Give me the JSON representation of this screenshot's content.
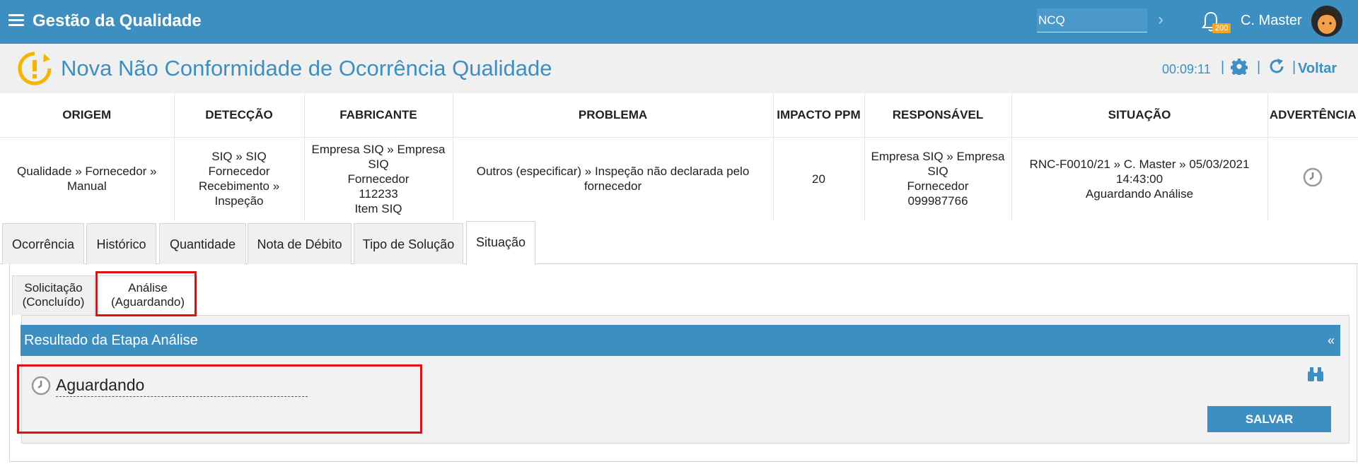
{
  "topbar": {
    "app_title": "Gestão da Qualidade",
    "search_value": "NCQ",
    "notification_count": "200",
    "user_name": "C. Master",
    "icons": [
      "menu-icon",
      "chevron-right-icon",
      "bell-icon",
      "avatar"
    ],
    "colors": {
      "bar": "#3d8fc1",
      "badge": "#f5a623"
    }
  },
  "header": {
    "title": "Nova Não Conformidade de Ocorrência Qualidade",
    "timer": "00:09:11",
    "back_label": "Voltar",
    "icons": [
      "warning-cycle-icon",
      "gear-icon",
      "refresh-icon"
    ]
  },
  "summary": {
    "columns": [
      "ORIGEM",
      "DETECÇÃO",
      "FABRICANTE",
      "PROBLEMA",
      "IMPACTO PPM",
      "RESPONSÁVEL",
      "SITUAÇÃO",
      "ADVERTÊNCIA"
    ],
    "row": {
      "origem": [
        "Qualidade » Fornecedor »",
        "Manual"
      ],
      "deteccao": [
        "SIQ » SIQ",
        "Fornecedor",
        "Recebimento »",
        "Inspeção"
      ],
      "fabricante": [
        "Empresa SIQ » Empresa",
        "SIQ",
        "Fornecedor",
        "112233",
        "Item SIQ"
      ],
      "problema": [
        "Outros (especificar) » Inspeção não declarada pelo",
        "fornecedor"
      ],
      "impacto_ppm": "20",
      "responsavel": [
        "Empresa SIQ » Empresa",
        "SIQ",
        "Fornecedor",
        "099987766"
      ],
      "situacao": [
        "RNC-F0010/21 » C. Master » 05/03/2021",
        "14:43:00",
        "Aguardando Análise"
      ],
      "advertencia_icon": "clock-icon"
    }
  },
  "tabs": [
    {
      "label": "Ocorrência",
      "active": false
    },
    {
      "label": "Histórico",
      "active": false
    },
    {
      "label": "Quantidade",
      "active": false
    },
    {
      "label": "Nota de Débito",
      "active": false
    },
    {
      "label": "Tipo de Solução",
      "active": false
    },
    {
      "label": "Situação",
      "active": true
    }
  ],
  "subtabs": [
    {
      "line1": "Solicitação",
      "line2": "(Concluído)",
      "active": false
    },
    {
      "line1": "Análise",
      "line2": "(Aguardando)",
      "active": true
    }
  ],
  "result": {
    "bar_title": "Resultado da Etapa Análise",
    "collapse_glyph": "«",
    "status": "Aguardando",
    "save_label": "SALVAR"
  },
  "highlight_color": "#e01010"
}
